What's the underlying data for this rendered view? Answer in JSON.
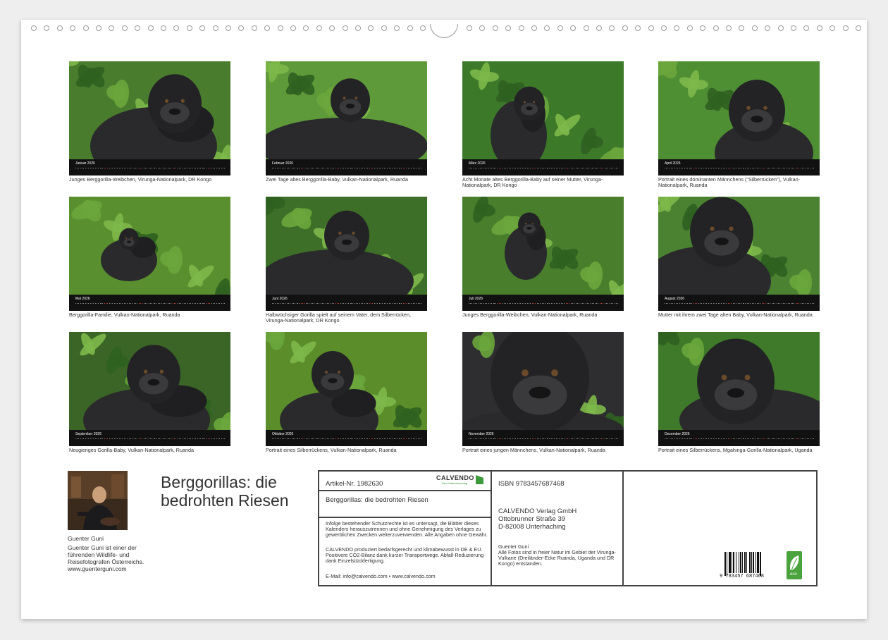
{
  "calendar_title": "Berggorillas: die bedrohten Riesen",
  "year": "2026",
  "months": [
    {
      "name": "Januar",
      "caption": "Junges Berggorilla-Weibchen, Virunga-Nationalpark, DR Kongo"
    },
    {
      "name": "Februar",
      "caption": "Zwei Tage altes Berggorilla-Baby, Vulkan-Nationalpark, Ruanda"
    },
    {
      "name": "März",
      "caption": "Acht Monate altes Berggorilla-Baby auf seiner Mutter, Virunga-Nationalpark, DR Kongo"
    },
    {
      "name": "April",
      "caption": "Portrait eines dominanten Männchens (\"Silberrücken\"), Vulkan-Nationalpark, Ruanda"
    },
    {
      "name": "Mai",
      "caption": "Berggorilla-Familie, Vulkan-Nationalpark, Ruanda"
    },
    {
      "name": "Juni",
      "caption": "Halbwüchsiger Gorilla spielt auf seinem Vater, dem Silberrücken, Virunga-Nationalpark, DR Kongo"
    },
    {
      "name": "Juli",
      "caption": "Junges Berggorilla-Weibchen, Vulkan-Nationalpark, Ruanda"
    },
    {
      "name": "August",
      "caption": "Mutter mit ihrem zwei Tage alten Baby, Vulkan-Nationalpark, Ruanda"
    },
    {
      "name": "September",
      "caption": "Neugieriges Gorilla-Baby, Vulkan-Nationalpark, Ruanda"
    },
    {
      "name": "Oktober",
      "caption": "Portrait eines Silberrückens, Vulkan-Nationalpark, Ruanda"
    },
    {
      "name": "November",
      "caption": "Portrait eines jungen Männchens, Vulkan-Nationalpark, Ruanda"
    },
    {
      "name": "Dezember",
      "caption": "Portrait eines Silberrückens, Mgahinga-Gorilla-Nationalpark, Uganda"
    }
  ],
  "author": {
    "name": "Guenter Guni",
    "description": "Guenter Guni ist einer der führenden Wildlife- und Reisefotografen Österreichs. www.guenterguni.com"
  },
  "info": {
    "article_no": "Artikel-Nr. 1982630",
    "brand": "CALVENDO",
    "brand_tagline": "Dein Kalenderverlag",
    "title": "Berggorillas: die bedrohten Riesen",
    "legal": "Infolge bestehender Schutzrechte ist es untersagt, die Blätter dieses Kalenders herauszutrennen und ohne Genehmigung des Verlages zu gewerblichen Zwecken weiterzuverwenden. Alle Angaben ohne Gewähr.",
    "eco_text": "CALVENDO produziert bedarfsgerecht und klimabewusst in DE & EU. Positivere CO2-Bilanz dank kurzer Transportwege. Abfall-Reduzierung dank Einzelstückfertigung.",
    "contact": "E-Mail: info@calvendo.com • www.calvendo.com",
    "isbn": "ISBN 9783457687468",
    "publisher_name": "CALVENDO Verlag GmbH",
    "publisher_street": "Ottobrunner Straße 39",
    "publisher_city": "D-82008 Unterhaching",
    "photo_author": "Guenter Guni",
    "photo_note": "Alle Fotos sind in freier Natur im Gebiet der Virunga-Vulkane (Dreiländer-Ecke Ruanda, Uganda und DR Kongo) entstanden.",
    "barcode_digits": "9 783457 687468",
    "eco_label": "eco"
  },
  "colors": {
    "leaf": "#3f7a2a",
    "leaf_light": "#7db84a",
    "gorilla": "#2a2a2c",
    "calvendo_green": "#3c9a3c"
  }
}
